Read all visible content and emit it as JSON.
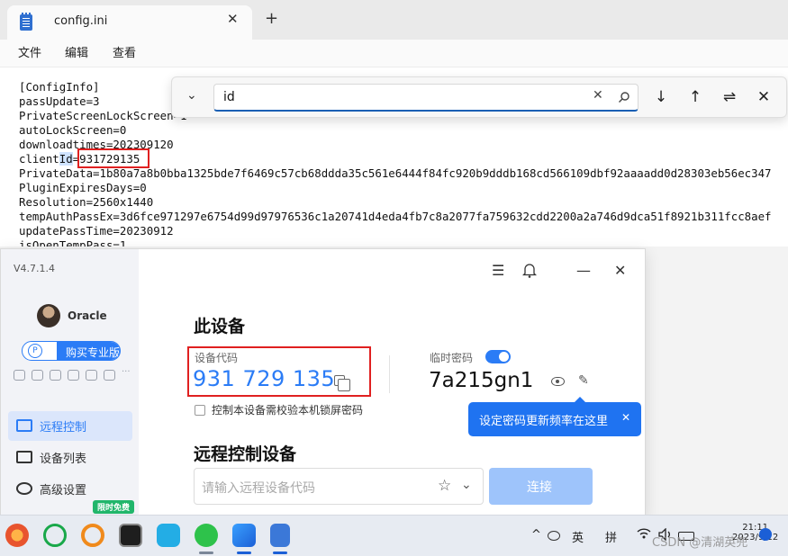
{
  "notepad": {
    "tab_title": "config.ini",
    "tab_close": "✕",
    "new_tab": "+",
    "menu": [
      "文件",
      "编辑",
      "查看"
    ],
    "lines": [
      "[ConfigInfo]",
      "passUpdate=3",
      "PrivateScreenLockScreen=1",
      "autoLockScreen=0",
      "downloadtimes=202309120",
      "clientId=931729135",
      "PrivateData=1b80a7a8b0bba1325bde7f6469c57cb68ddda35c561e6444f84fc920b9dddb168cd566109dbf92aaaadd0d28303eb56ec347",
      "PluginExpiresDays=0",
      "Resolution=2560x1440",
      "tempAuthPassEx=3d6fce971297e6754d99d97976536c1a20741d4eda4fb7c8a2077fa759632cdd2200a2a746d9dca51f8921b311fcc8aef",
      "updatePassTime=20230912",
      "isOpenTempPass=1"
    ],
    "client_id_parts": [
      "client",
      "Id",
      "=",
      "931729135"
    ]
  },
  "findbar": {
    "query": "id",
    "clear": "✕",
    "down": "↓",
    "up": "↑",
    "options": "⇌",
    "close": "✕",
    "chevron": "⌄"
  },
  "todesk": {
    "version": "V4.7.1.4",
    "user": "Oracle",
    "pro_badge": "P",
    "pro_label": "购买专业版",
    "nav": [
      "远程控制",
      "设备列表",
      "高级设置"
    ],
    "free_badge": "限时免费",
    "controls": {
      "menu": "☰",
      "bell": "🔔",
      "min": "—",
      "close": "✕"
    },
    "this_device": "此设备",
    "device_code_label": "设备代码",
    "device_code": "931 729 135",
    "temp_pass_label": "临时密码",
    "temp_pass": "7a215gn1",
    "pencil": "✎",
    "lock_check_label": "控制本设备需校验本机锁屏密码",
    "tooltip": "设定密码更新频率在这里",
    "tooltip_close": "✕",
    "remote_title": "远程控制设备",
    "remote_placeholder": "请输入远程设备代码",
    "star": "☆",
    "dropdown": "⌄",
    "connect": "连接"
  },
  "taskbar": {
    "sys_chevron": "^",
    "ime1": "英",
    "ime2": "拼",
    "time": "21:11",
    "date": "2023/9/12"
  },
  "watermark": "CSDN @清湖英兜"
}
